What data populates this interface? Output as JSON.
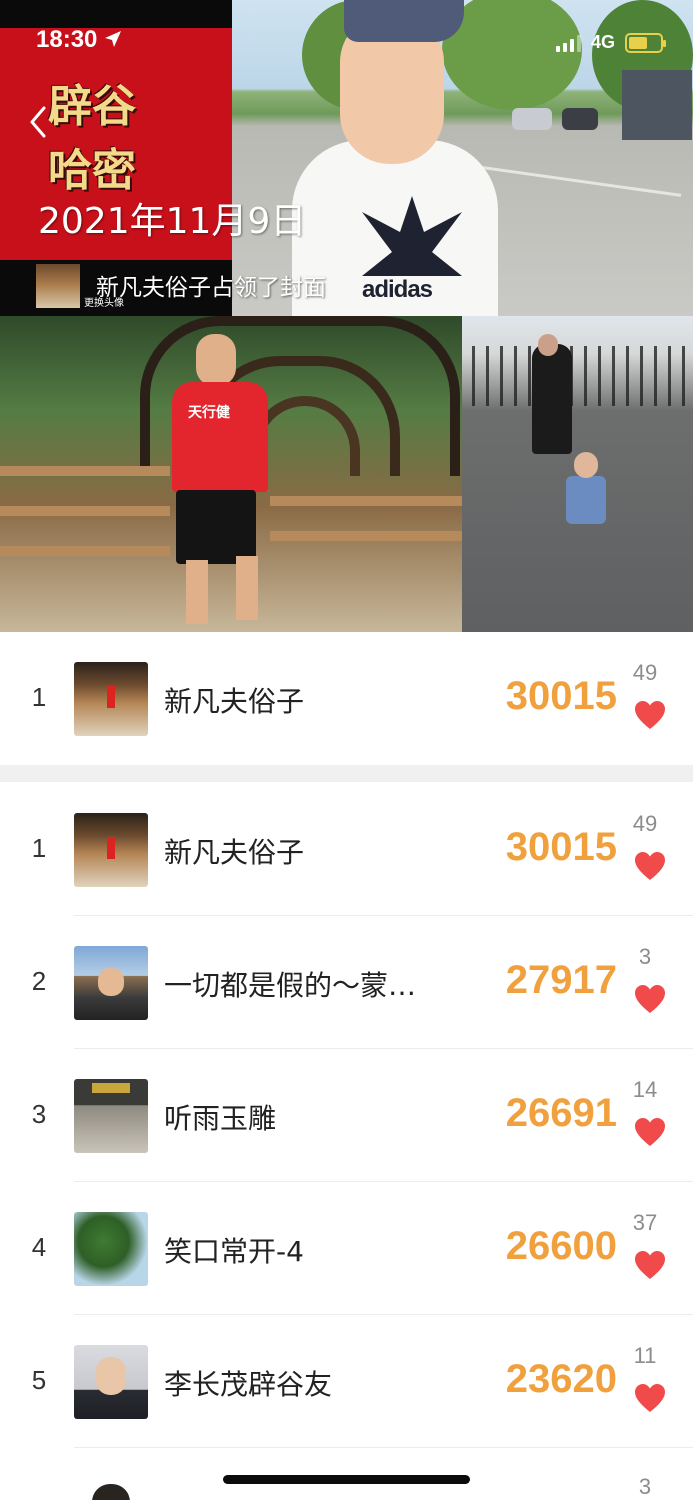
{
  "status_bar": {
    "time": "18:30",
    "network": "4G"
  },
  "cover": {
    "banner_line1": "辟谷",
    "banner_line2": "哈密",
    "date": "2021年11月9日",
    "avatar_tip": "更换头像",
    "message": "新凡夫俗子占领了封面",
    "shirt_brand": "adidas",
    "shirt_print": "天行健"
  },
  "my_rank": {
    "rank": "1",
    "name": "新凡夫俗子",
    "steps": "30015",
    "likes": "49"
  },
  "leaderboard": [
    {
      "rank": "1",
      "name": "新凡夫俗子",
      "steps": "30015",
      "likes": "49"
    },
    {
      "rank": "2",
      "name": "一切都是假的～蒙…",
      "steps": "27917",
      "likes": "3"
    },
    {
      "rank": "3",
      "name": "听雨玉雕",
      "steps": "26691",
      "likes": "14"
    },
    {
      "rank": "4",
      "name": "笑口常开-4",
      "steps": "26600",
      "likes": "37"
    },
    {
      "rank": "5",
      "name": "李长茂辟谷友",
      "steps": "23620",
      "likes": "11"
    }
  ],
  "partial_row": {
    "likes": "3"
  },
  "colors": {
    "accent_steps": "#f0a03c",
    "heart": "#f04a4a",
    "banner_red": "#c8101a"
  },
  "icons": {
    "back": "chevron-left-icon",
    "like": "heart-icon",
    "location": "location-arrow-icon"
  }
}
